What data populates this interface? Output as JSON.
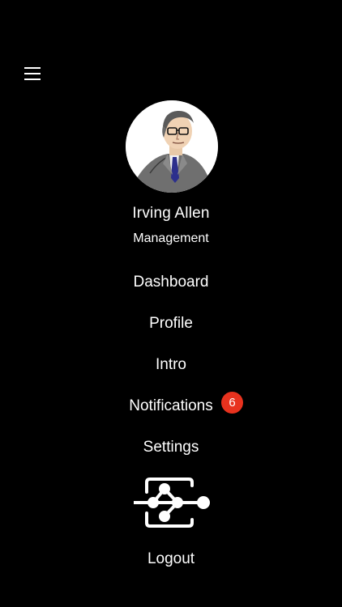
{
  "header": {
    "menu_icon": "hamburger-menu-icon"
  },
  "user": {
    "name": "Irving Allen",
    "role": "Management",
    "avatar_icon": "user-avatar-icon"
  },
  "nav": {
    "dashboard": "Dashboard",
    "profile": "Profile",
    "intro": "Intro",
    "notifications": "Notifications",
    "notifications_badge": "6",
    "settings": "Settings",
    "logout": "Logout"
  },
  "logo": {
    "icon": "network-logo-icon"
  },
  "colors": {
    "background": "#000000",
    "text": "#ffffff",
    "badge": "#e8321e"
  }
}
